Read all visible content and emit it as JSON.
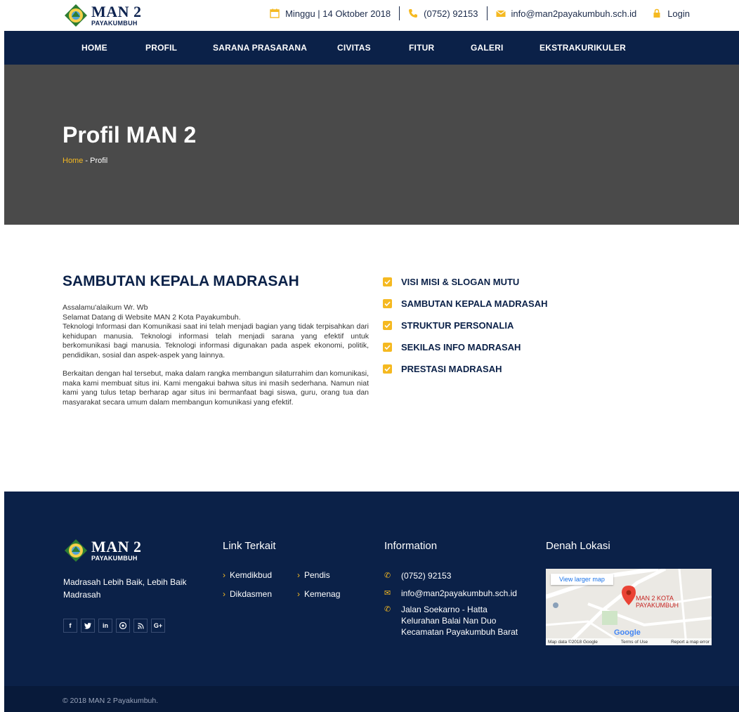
{
  "header": {
    "logo_main": "MAN 2",
    "logo_sub": "PAYAKUMBUH",
    "date": "Minggu | 14 Oktober 2018",
    "phone": "(0752) 92153",
    "email": "info@man2payakumbuh.sch.id",
    "login": "Login"
  },
  "nav": [
    "HOME",
    "PROFIL",
    "SARANA PRASARANA",
    "CIVITAS",
    "FITUR",
    "GALERI",
    "EKSTRAKURIKULER"
  ],
  "hero": {
    "title": "Profil MAN 2",
    "breadcrumb_home": "Home",
    "breadcrumb_sep": " - ",
    "breadcrumb_current": "Profil"
  },
  "content": {
    "title": "SAMBUTAN KEPALA MADRASAH",
    "p1": "Assalamu'alaikum Wr. Wb\nSelamat Datang di Website MAN 2 Kota Payakumbuh.\nTeknologi Informasi dan Komunikasi saat ini telah menjadi bagian yang tidak terpisahkan dari kehidupan manusia. Teknologi informasi telah menjadi sarana yang efektif untuk berkomunikasi bagi manusia. Teknologi informasi digunakan pada aspek ekonomi, politik, pendidikan, sosial dan aspek-aspek yang lainnya.",
    "p2": "Berkaitan dengan hal tersebut, maka dalam rangka membangun silaturrahim dan komunikasi, maka kami membuat situs ini. Kami mengakui bahwa situs ini masih sederhana. Namun niat kami yang tulus tetap berharap agar situs ini bermanfaat bagi siswa, guru, orang tua dan masyarakat secara umum dalam membangun komunikasi yang efektif."
  },
  "side_menu": [
    "VISI MISI & SLOGAN MUTU",
    "SAMBUTAN KEPALA MADRASAH",
    "STRUKTUR PERSONALIA",
    "SEKILAS INFO MADRASAH",
    "PRESTASI MADRASAH"
  ],
  "footer": {
    "logo_main": "MAN 2",
    "logo_sub": "PAYAKUMBUH",
    "tagline": "Madrasah Lebih Baik, Lebih Baik Madrasah",
    "social": [
      "f",
      "y",
      "in",
      "p",
      "rss",
      "G+"
    ],
    "links_title": "Link Terkait",
    "links": [
      "Kemdikbud",
      "Pendis",
      "Dikdasmen",
      "Kemenag"
    ],
    "info_title": "Information",
    "info_phone": "(0752) 92153",
    "info_email": "info@man2payakumbuh.sch.id",
    "info_address": "Jalan Soekarno - Hatta\nKelurahan Balai Nan Duo\nKecamatan Payakumbuh Barat",
    "map_title": "Denah Lokasi",
    "map_button": "View larger map",
    "map_place": "MAN 2 KOTA\nPAYAKUMBUH",
    "map_google": "Google",
    "map_data": "Map data ©2018 Google",
    "map_terms": "Terms of Use",
    "map_report": "Report a map error",
    "copyright": "© 2018 MAN 2 Payakumbuh."
  },
  "colors": {
    "navy": "#0b2148",
    "accent": "#f5b921",
    "hero_bg": "#4a4a4a"
  }
}
